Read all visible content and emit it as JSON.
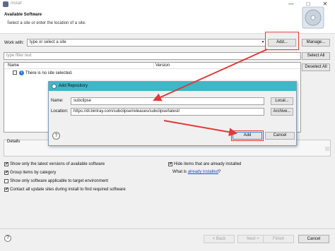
{
  "window": {
    "title": "Install",
    "minimize": "—",
    "maximize": "□",
    "close": "✕"
  },
  "header": {
    "heading": "Available Software",
    "subheading": "Select a site or enter the location of a site."
  },
  "work_with": {
    "label": "Work with:",
    "value": "type or select a site",
    "add_label": "Add...",
    "manage_label": "Manage..."
  },
  "filter": {
    "placeholder": "type filter text"
  },
  "side_buttons": {
    "select_all": "Select All",
    "deselect_all": "Deselect All"
  },
  "tree": {
    "col_name": "Name",
    "col_version": "Version",
    "row_text": "There is no site selected."
  },
  "dialog": {
    "title": "Add Repository",
    "name_label": "Name:",
    "name_value": "subclipse",
    "local_label": "Local...",
    "location_label": "Location:",
    "location_value": "https://dl.bintray.com/subclipse/releases/subclipse/latest/",
    "archive_label": "Archive...",
    "help": "?",
    "add_label": "Add",
    "cancel_label": "Cancel"
  },
  "details": {
    "label": "Details"
  },
  "options": [
    {
      "label": "Show only the latest versions of available software",
      "checked": "✔"
    },
    {
      "label": "Group items by category",
      "checked": "✔"
    },
    {
      "label": "Show only software applicable to target environment",
      "checked": ""
    },
    {
      "label": "Contact all update sites during install to find required software",
      "checked": "✔"
    }
  ],
  "right_options": {
    "hide_label": "Hide items that are already installed",
    "hide_checked": "✔",
    "what_prefix": "What is",
    "what_link": "already installed",
    "what_suffix": "?"
  },
  "footer": {
    "help": "?",
    "back": "< Back",
    "next": "Next >",
    "finish": "Finish",
    "cancel": "Cancel"
  },
  "colors": {
    "annotation": "#e03a3a",
    "dialog_title": "#3cb8c6",
    "link": "#1a4fc9"
  },
  "icons": [
    "app-icon",
    "banner-cd-icon",
    "info-icon",
    "help-icon",
    "arrow-annotation"
  ]
}
